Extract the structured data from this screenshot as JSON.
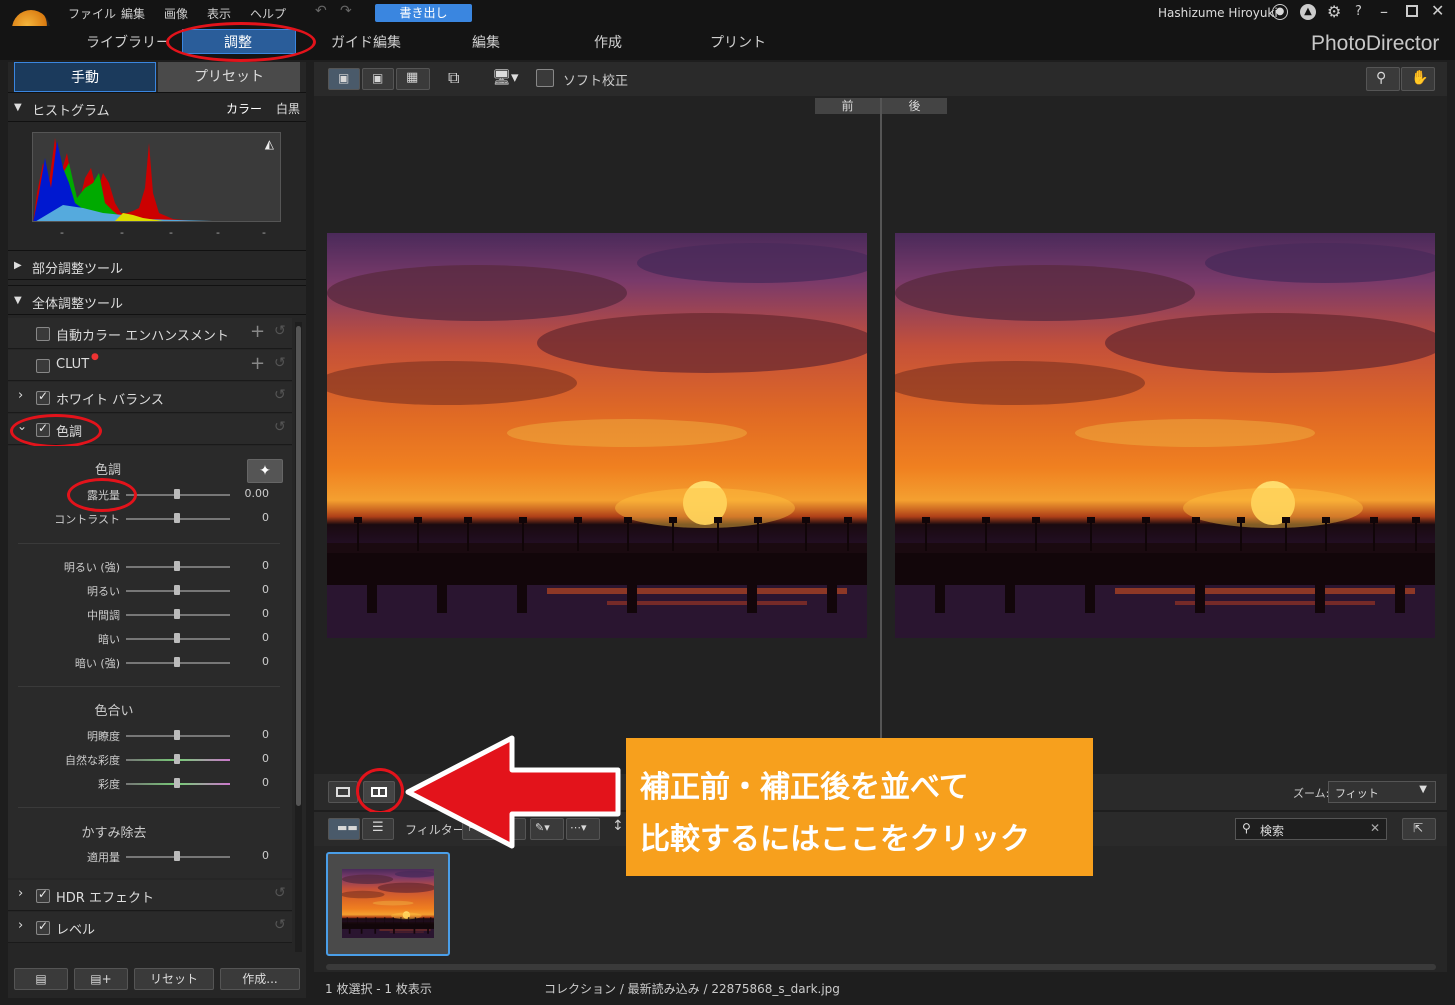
{
  "menu": [
    "ファイル",
    "編集",
    "画像",
    "表示",
    "ヘルプ"
  ],
  "export_label": "書き出し",
  "user_name": "Hashizume Hiroyuki",
  "module_tabs": [
    "ライブラリー",
    "調整",
    "ガイド編集",
    "編集",
    "作成",
    "プリント"
  ],
  "brand": "PhotoDirector",
  "subtabs": [
    "手動",
    "プリセット"
  ],
  "histogram": {
    "title": "ヒストグラム",
    "color_label": "カラー",
    "bw_label": "白黒",
    "stats": [
      "-",
      "-",
      "-",
      "-",
      "-"
    ]
  },
  "sections": {
    "local": "部分調整ツール",
    "global": "全体調整ツール"
  },
  "tools": {
    "auto_color": "自動カラー エンハンスメント",
    "clut": "CLUT",
    "white_balance": "ホワイト バランス",
    "tone": "色調",
    "hdr": "HDR エフェクト",
    "levels": "レベル"
  },
  "tone_panel": {
    "group1": "色調",
    "sliders1": [
      {
        "label": "露光量",
        "value": "0.00"
      },
      {
        "label": "コントラスト",
        "value": "0"
      }
    ],
    "sliders2": [
      {
        "label": "明るい (強)",
        "value": "0"
      },
      {
        "label": "明るい",
        "value": "0"
      },
      {
        "label": "中間調",
        "value": "0"
      },
      {
        "label": "暗い",
        "value": "0"
      },
      {
        "label": "暗い (強)",
        "value": "0"
      }
    ],
    "group2": "色合い",
    "sliders3": [
      {
        "label": "明瞭度",
        "value": "0"
      },
      {
        "label": "自然な彩度",
        "value": "0"
      },
      {
        "label": "彩度",
        "value": "0"
      }
    ],
    "group3": "かすみ除去",
    "sliders4": [
      {
        "label": "適用量",
        "value": "0"
      }
    ]
  },
  "bottom_buttons": {
    "reset": "リセット",
    "create": "作成..."
  },
  "toolbar": {
    "soft_proof": "ソフト校正"
  },
  "compare": {
    "before": "前",
    "after": "後"
  },
  "zoom": {
    "label": "ズーム:",
    "value": "フィット"
  },
  "filter_label": "フィルター:",
  "search_placeholder": "検索",
  "status": {
    "selection": "1 枚選択 - 1 枚表示",
    "path": "コレクション / 最新読み込み / 22875868_s_dark.jpg"
  },
  "callout": {
    "line1": "補正前・補正後を並べて",
    "line2": "比較するにはここをクリック"
  },
  "colors": {
    "accent": "#3a86e0",
    "annotation_red": "#e3131b",
    "callout_bg": "#f7a01d"
  }
}
